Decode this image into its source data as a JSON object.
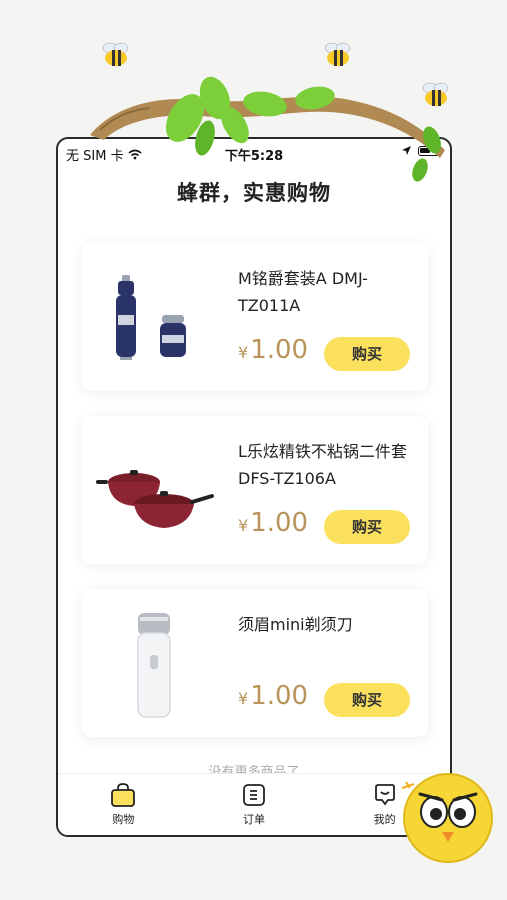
{
  "status_bar": {
    "carrier": "无 SIM 卡",
    "time": "下午5:28"
  },
  "header": {
    "title": "蜂群，实惠购物"
  },
  "products": [
    {
      "name": "M铭爵套装A DMJ-TZ011A",
      "currency": "¥",
      "price": "1.00",
      "buy_label": "购买",
      "image_icon": "vacuum-flask-set"
    },
    {
      "name": "L乐炫精铁不粘锅二件套DFS-TZ106A",
      "currency": "¥",
      "price": "1.00",
      "buy_label": "购买",
      "image_icon": "nonstick-pan-set"
    },
    {
      "name": "须眉mini剃须刀",
      "currency": "¥",
      "price": "1.00",
      "buy_label": "购买",
      "image_icon": "mini-shaver"
    }
  ],
  "list_footer": "没有更多商品了",
  "tabbar": {
    "tabs": [
      {
        "label": "购物",
        "icon": "shopping-bag-icon",
        "active": true
      },
      {
        "label": "订单",
        "icon": "order-icon",
        "active": false
      },
      {
        "label": "我的",
        "icon": "profile-icon",
        "active": false
      }
    ]
  },
  "colors": {
    "accent": "#fbe05e",
    "price": "#b8945a",
    "leaf": "#7dcf3a"
  }
}
